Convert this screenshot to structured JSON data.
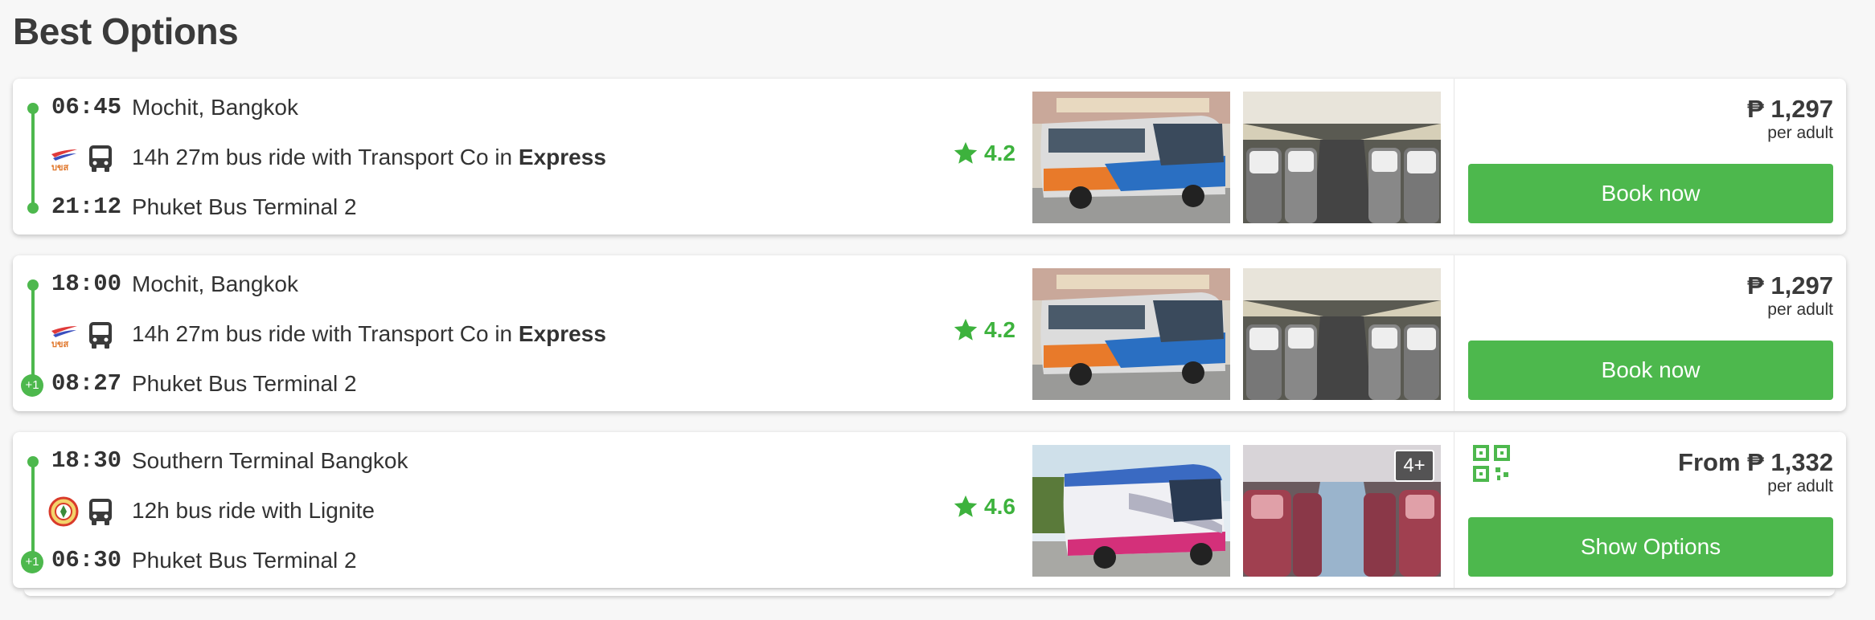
{
  "heading": "Best Options",
  "options": [
    {
      "departure_time": "06:45",
      "departure_station": "Mochit, Bangkok",
      "ride_text": "14h 27m bus ride with Transport Co in",
      "ride_class": "Express",
      "arrival_time": "21:12",
      "arrival_station": "Phuket Bus Terminal 2",
      "next_day": "",
      "rating": "4.2",
      "price": "₱ 1,297",
      "price_unit": "per adult",
      "cta_label": "Book now"
    },
    {
      "departure_time": "18:00",
      "departure_station": "Mochit, Bangkok",
      "ride_text": "14h 27m bus ride with Transport Co in",
      "ride_class": "Express",
      "arrival_time": "08:27",
      "arrival_station": "Phuket Bus Terminal 2",
      "next_day": "+1",
      "rating": "4.2",
      "price": "₱ 1,297",
      "price_unit": "per adult",
      "cta_label": "Book now"
    },
    {
      "departure_time": "18:30",
      "departure_station": "Southern Terminal Bangkok",
      "ride_text": "12h bus ride with Lignite",
      "ride_class": "",
      "arrival_time": "06:30",
      "arrival_station": "Phuket Bus Terminal 2",
      "next_day": "+1",
      "rating": "4.6",
      "more_photos": "4+",
      "price": "From ₱ 1,332",
      "price_unit": "per adult",
      "cta_label": "Show Options"
    }
  ],
  "colors": {
    "accent": "#4db84d",
    "rating": "#3db23d"
  },
  "icons": [
    "bus-icon",
    "star-icon",
    "qr-code-icon",
    "transport-co-logo",
    "lignite-logo"
  ]
}
